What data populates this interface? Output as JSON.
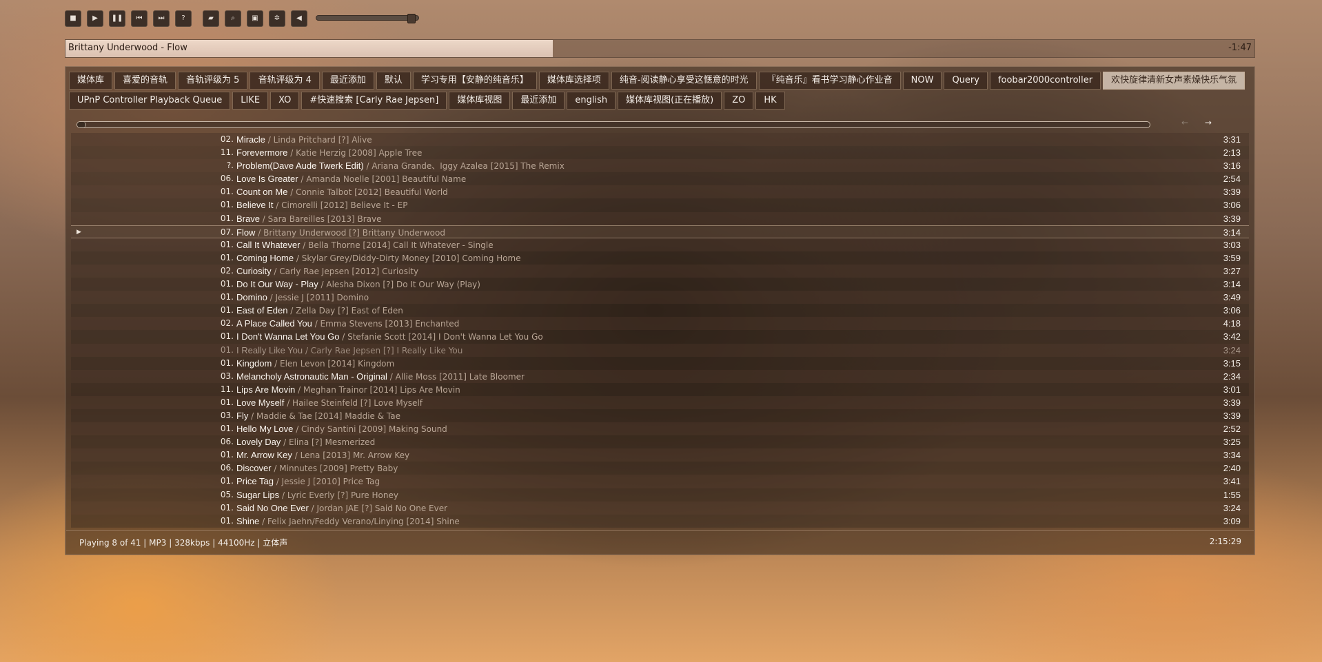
{
  "toolbar": {
    "buttons": [
      {
        "name": "stop-button",
        "glyph": "■"
      },
      {
        "name": "play-button",
        "glyph": "▶"
      },
      {
        "name": "pause-button",
        "glyph": "❚❚"
      },
      {
        "name": "previous-button",
        "glyph": "⏮"
      },
      {
        "name": "next-button",
        "glyph": "⏭"
      },
      {
        "name": "random-button",
        "glyph": "?"
      },
      {
        "name": "open-button",
        "glyph": "▰"
      },
      {
        "name": "search-button",
        "glyph": "⌕"
      },
      {
        "name": "album-art-button",
        "glyph": "▣"
      },
      {
        "name": "settings-button",
        "glyph": "✲"
      },
      {
        "name": "volume-button",
        "glyph": "◀"
      }
    ],
    "volume_level": 0.95
  },
  "now_playing": {
    "title": "Brittany Underwood - Flow",
    "remaining": "-1:47",
    "progress": 0.41
  },
  "tabs": {
    "row1": [
      "媒体库",
      "喜爱的音轨",
      "音轨评级为 5",
      "音轨评级为 4",
      "最近添加",
      "默认",
      "学习专用【安静的纯音乐】",
      "媒体库选择项",
      "纯音-阅读静心享受这惬意的时光",
      "『纯音乐』看书学习静心作业音",
      "NOW",
      "Query",
      "foobar2000controller",
      "欢快旋律清新女声素燥快乐气氛"
    ],
    "row2": [
      "UPnP Controller Playback Queue",
      "LIKE",
      "XO",
      "#快速搜索 [Carly Rae Jepsen]",
      "媒体库视图",
      "最近添加",
      "english",
      "媒体库视图(正在播放)",
      "ZO",
      "HK"
    ],
    "active": "欢快旋律清新女声素燥快乐气氛"
  },
  "nav": {
    "back": "←",
    "forward": "→"
  },
  "tracks": [
    {
      "num": "02.",
      "title": "Miracle",
      "meta": " / Linda Pritchard [?] Alive",
      "dur": "3:31"
    },
    {
      "num": "11.",
      "title": "Forevermore",
      "meta": " / Katie Herzig [2008] Apple Tree",
      "dur": "2:13"
    },
    {
      "num": "?.",
      "title": "Problem(Dave Aude Twerk Edit)",
      "meta": " / Ariana Grande、Iggy Azalea [2015] The Remix",
      "dur": "3:16"
    },
    {
      "num": "06.",
      "title": "Love Is Greater",
      "meta": " / Amanda Noelle [2001] Beautiful Name",
      "dur": "2:54"
    },
    {
      "num": "01.",
      "title": "Count on Me",
      "meta": " / Connie Talbot [2012] Beautiful World",
      "dur": "3:39"
    },
    {
      "num": "01.",
      "title": "Believe It",
      "meta": " / Cimorelli [2012] Believe It - EP",
      "dur": "3:06"
    },
    {
      "num": "01.",
      "title": "Brave",
      "meta": " / Sara Bareilles [2013] Brave",
      "dur": "3:39"
    },
    {
      "num": "07.",
      "title": "Flow",
      "meta": " / Brittany Underwood [?] Brittany Underwood",
      "dur": "3:14",
      "playing": true
    },
    {
      "num": "01.",
      "title": "Call It Whatever",
      "meta": " / Bella Thorne [2014] Call It Whatever - Single",
      "dur": "3:03"
    },
    {
      "num": "01.",
      "title": "Coming Home",
      "meta": " / Skylar Grey/Diddy-Dirty Money [2010] Coming Home",
      "dur": "3:59"
    },
    {
      "num": "02.",
      "title": "Curiosity",
      "meta": " / Carly Rae Jepsen [2012] Curiosity",
      "dur": "3:27"
    },
    {
      "num": "01.",
      "title": "Do It Our Way - Play",
      "meta": " / Alesha Dixon [?] Do It Our Way (Play)",
      "dur": "3:14"
    },
    {
      "num": "01.",
      "title": "Domino",
      "meta": " / Jessie J [2011] Domino",
      "dur": "3:49"
    },
    {
      "num": "01.",
      "title": "East of Eden",
      "meta": " / Zella Day [?] East of Eden",
      "dur": "3:06"
    },
    {
      "num": "02.",
      "title": "A Place Called You",
      "meta": " / Emma Stevens [2013] Enchanted",
      "dur": "4:18"
    },
    {
      "num": "01.",
      "title": "I Don't Wanna Let You Go",
      "meta": " / Stefanie Scott [2014] I Don't Wanna Let You Go",
      "dur": "3:42"
    },
    {
      "num": "01.",
      "title": "I Really Like You",
      "meta": " / Carly Rae Jepsen [?] I Really Like You",
      "dur": "3:24",
      "faded": true
    },
    {
      "num": "01.",
      "title": "Kingdom",
      "meta": " / Elen Levon [2014] Kingdom",
      "dur": "3:15"
    },
    {
      "num": "03.",
      "title": "Melancholy Astronautic Man - Original",
      "meta": " / Allie Moss [2011] Late Bloomer",
      "dur": "2:34"
    },
    {
      "num": "11.",
      "title": "Lips Are Movin",
      "meta": " / Meghan Trainor [2014] Lips Are Movin",
      "dur": "3:01"
    },
    {
      "num": "01.",
      "title": "Love Myself",
      "meta": " / Hailee Steinfeld [?] Love Myself",
      "dur": "3:39"
    },
    {
      "num": "03.",
      "title": "Fly",
      "meta": " / Maddie & Tae [2014] Maddie & Tae",
      "dur": "3:39"
    },
    {
      "num": "01.",
      "title": "Hello My Love",
      "meta": " / Cindy Santini [2009] Making Sound",
      "dur": "2:52"
    },
    {
      "num": "06.",
      "title": "Lovely Day",
      "meta": " / Elina [?] Mesmerized",
      "dur": "3:25"
    },
    {
      "num": "01.",
      "title": "Mr. Arrow Key",
      "meta": " / Lena [2013] Mr. Arrow Key",
      "dur": "3:34"
    },
    {
      "num": "06.",
      "title": "Discover",
      "meta": " / Minnutes [2009] Pretty Baby",
      "dur": "2:40"
    },
    {
      "num": "01.",
      "title": "Price Tag",
      "meta": " / Jessie J [2010] Price Tag",
      "dur": "3:41"
    },
    {
      "num": "05.",
      "title": "Sugar Lips",
      "meta": " / Lyric Everly [?] Pure Honey",
      "dur": "1:55"
    },
    {
      "num": "01.",
      "title": "Said No One Ever",
      "meta": " / Jordan JAE [?] Said No One Ever",
      "dur": "3:24"
    },
    {
      "num": "01.",
      "title": "Shine",
      "meta": " / Felix Jaehn/Feddy Verano/Linying [2014] Shine",
      "dur": "3:09"
    }
  ],
  "playing_marker": "▶",
  "status": {
    "left": "Playing 8 of 41 | MP3 | 328kbps | 44100Hz | 立体声",
    "total": "2:15:29"
  }
}
